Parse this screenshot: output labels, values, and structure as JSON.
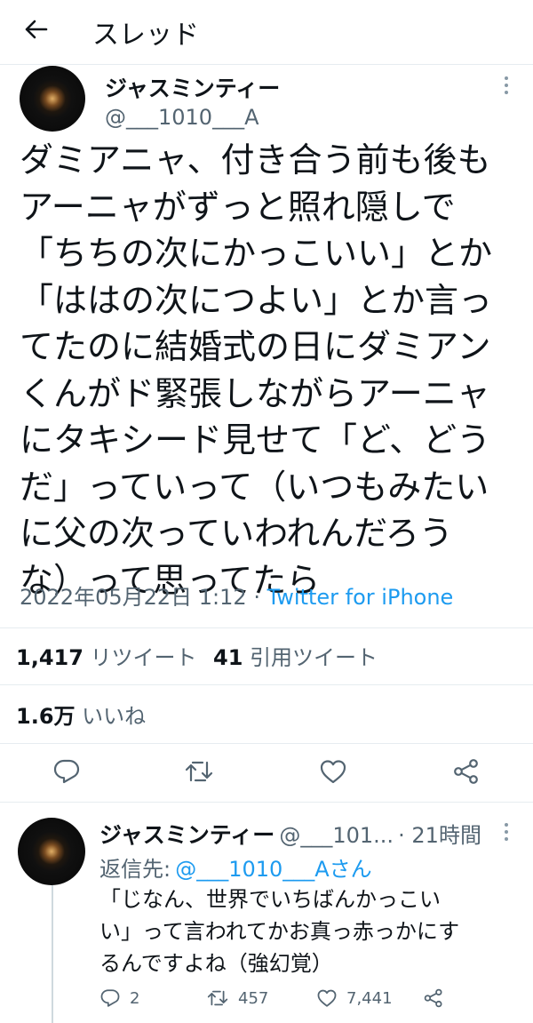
{
  "header": {
    "title": "スレッド",
    "back_icon": "arrow-left-icon"
  },
  "tweet": {
    "author_name": "ジャスミンティー",
    "handle": "@___1010___A",
    "text": "ダミアニャ、付き合う前も後も\nアーニャがずっと照れ隠しで\n「ちちの次にかっこいい」とか\n「ははの次につよい」とか言っ\nてたのに結婚式の日にダミアン\nくんがド緊張しながらアーニャ\nにタキシード見せて「ど、どう\nだ」っていって（いつもみたい\nに父の次っていわれんだろう\nな）って思ってたら",
    "datetime": "2022年05月22日 1:12",
    "separator": "·",
    "source": "Twitter for iPhone",
    "retweets_count": "1,417",
    "retweets_label": "リツイート",
    "quotes_count": "41",
    "quotes_label": "引用ツイート",
    "likes_count": "1.6万",
    "likes_label": "いいね"
  },
  "reply": {
    "author_name": "ジャスミンティー",
    "handle": "@___101...",
    "time": "· 21時間",
    "reply_to_label": "返信先:",
    "reply_to_handle": "@___1010___Aさん",
    "text": "「じなん、世界でいちばんかっこい\nい」って言われてかお真っ赤っかにす\nるんですよね（強幻覚）",
    "reply_count": "2",
    "retweet_count": "457",
    "like_count": "7,441"
  },
  "colors": {
    "accent": "#1d9bf0",
    "text": "#0f1419",
    "secondary": "#536471",
    "divider": "#e6ecf0"
  }
}
